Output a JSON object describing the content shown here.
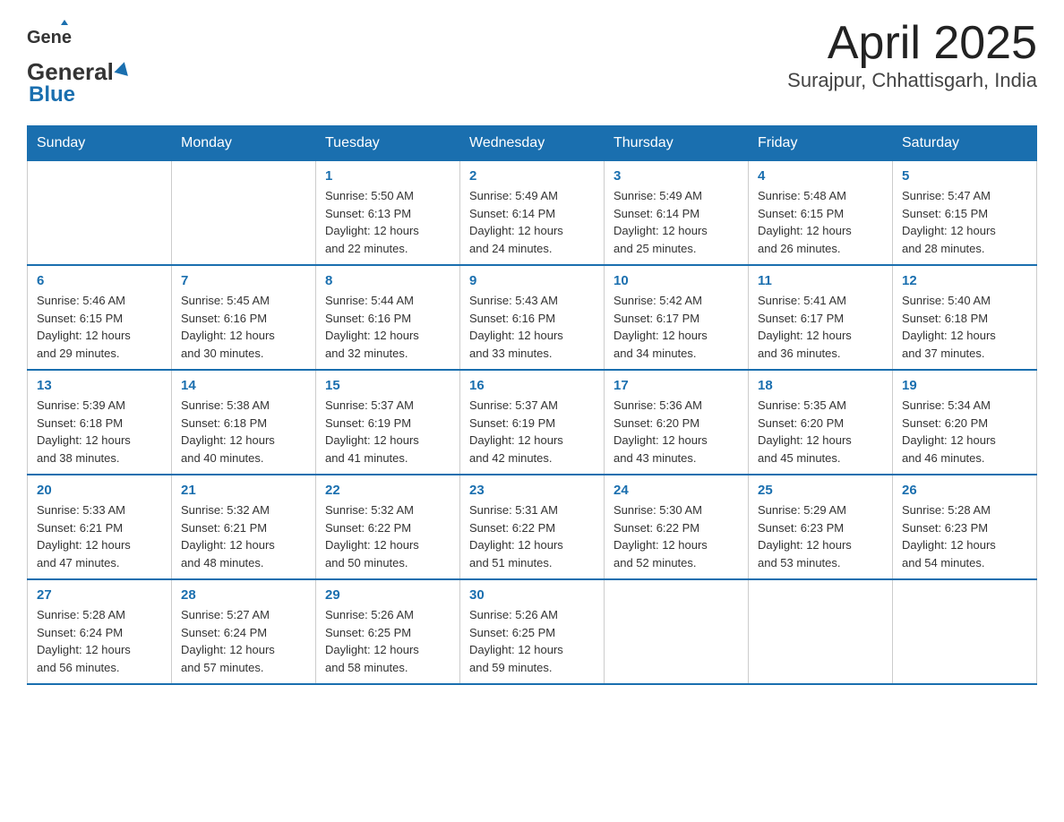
{
  "header": {
    "logo_general": "General",
    "logo_blue": "Blue",
    "title": "April 2025",
    "subtitle": "Surajpur, Chhattisgarh, India"
  },
  "days_of_week": [
    "Sunday",
    "Monday",
    "Tuesday",
    "Wednesday",
    "Thursday",
    "Friday",
    "Saturday"
  ],
  "weeks": [
    [
      {
        "day": "",
        "info": ""
      },
      {
        "day": "",
        "info": ""
      },
      {
        "day": "1",
        "info": "Sunrise: 5:50 AM\nSunset: 6:13 PM\nDaylight: 12 hours\nand 22 minutes."
      },
      {
        "day": "2",
        "info": "Sunrise: 5:49 AM\nSunset: 6:14 PM\nDaylight: 12 hours\nand 24 minutes."
      },
      {
        "day": "3",
        "info": "Sunrise: 5:49 AM\nSunset: 6:14 PM\nDaylight: 12 hours\nand 25 minutes."
      },
      {
        "day": "4",
        "info": "Sunrise: 5:48 AM\nSunset: 6:15 PM\nDaylight: 12 hours\nand 26 minutes."
      },
      {
        "day": "5",
        "info": "Sunrise: 5:47 AM\nSunset: 6:15 PM\nDaylight: 12 hours\nand 28 minutes."
      }
    ],
    [
      {
        "day": "6",
        "info": "Sunrise: 5:46 AM\nSunset: 6:15 PM\nDaylight: 12 hours\nand 29 minutes."
      },
      {
        "day": "7",
        "info": "Sunrise: 5:45 AM\nSunset: 6:16 PM\nDaylight: 12 hours\nand 30 minutes."
      },
      {
        "day": "8",
        "info": "Sunrise: 5:44 AM\nSunset: 6:16 PM\nDaylight: 12 hours\nand 32 minutes."
      },
      {
        "day": "9",
        "info": "Sunrise: 5:43 AM\nSunset: 6:16 PM\nDaylight: 12 hours\nand 33 minutes."
      },
      {
        "day": "10",
        "info": "Sunrise: 5:42 AM\nSunset: 6:17 PM\nDaylight: 12 hours\nand 34 minutes."
      },
      {
        "day": "11",
        "info": "Sunrise: 5:41 AM\nSunset: 6:17 PM\nDaylight: 12 hours\nand 36 minutes."
      },
      {
        "day": "12",
        "info": "Sunrise: 5:40 AM\nSunset: 6:18 PM\nDaylight: 12 hours\nand 37 minutes."
      }
    ],
    [
      {
        "day": "13",
        "info": "Sunrise: 5:39 AM\nSunset: 6:18 PM\nDaylight: 12 hours\nand 38 minutes."
      },
      {
        "day": "14",
        "info": "Sunrise: 5:38 AM\nSunset: 6:18 PM\nDaylight: 12 hours\nand 40 minutes."
      },
      {
        "day": "15",
        "info": "Sunrise: 5:37 AM\nSunset: 6:19 PM\nDaylight: 12 hours\nand 41 minutes."
      },
      {
        "day": "16",
        "info": "Sunrise: 5:37 AM\nSunset: 6:19 PM\nDaylight: 12 hours\nand 42 minutes."
      },
      {
        "day": "17",
        "info": "Sunrise: 5:36 AM\nSunset: 6:20 PM\nDaylight: 12 hours\nand 43 minutes."
      },
      {
        "day": "18",
        "info": "Sunrise: 5:35 AM\nSunset: 6:20 PM\nDaylight: 12 hours\nand 45 minutes."
      },
      {
        "day": "19",
        "info": "Sunrise: 5:34 AM\nSunset: 6:20 PM\nDaylight: 12 hours\nand 46 minutes."
      }
    ],
    [
      {
        "day": "20",
        "info": "Sunrise: 5:33 AM\nSunset: 6:21 PM\nDaylight: 12 hours\nand 47 minutes."
      },
      {
        "day": "21",
        "info": "Sunrise: 5:32 AM\nSunset: 6:21 PM\nDaylight: 12 hours\nand 48 minutes."
      },
      {
        "day": "22",
        "info": "Sunrise: 5:32 AM\nSunset: 6:22 PM\nDaylight: 12 hours\nand 50 minutes."
      },
      {
        "day": "23",
        "info": "Sunrise: 5:31 AM\nSunset: 6:22 PM\nDaylight: 12 hours\nand 51 minutes."
      },
      {
        "day": "24",
        "info": "Sunrise: 5:30 AM\nSunset: 6:22 PM\nDaylight: 12 hours\nand 52 minutes."
      },
      {
        "day": "25",
        "info": "Sunrise: 5:29 AM\nSunset: 6:23 PM\nDaylight: 12 hours\nand 53 minutes."
      },
      {
        "day": "26",
        "info": "Sunrise: 5:28 AM\nSunset: 6:23 PM\nDaylight: 12 hours\nand 54 minutes."
      }
    ],
    [
      {
        "day": "27",
        "info": "Sunrise: 5:28 AM\nSunset: 6:24 PM\nDaylight: 12 hours\nand 56 minutes."
      },
      {
        "day": "28",
        "info": "Sunrise: 5:27 AM\nSunset: 6:24 PM\nDaylight: 12 hours\nand 57 minutes."
      },
      {
        "day": "29",
        "info": "Sunrise: 5:26 AM\nSunset: 6:25 PM\nDaylight: 12 hours\nand 58 minutes."
      },
      {
        "day": "30",
        "info": "Sunrise: 5:26 AM\nSunset: 6:25 PM\nDaylight: 12 hours\nand 59 minutes."
      },
      {
        "day": "",
        "info": ""
      },
      {
        "day": "",
        "info": ""
      },
      {
        "day": "",
        "info": ""
      }
    ]
  ]
}
